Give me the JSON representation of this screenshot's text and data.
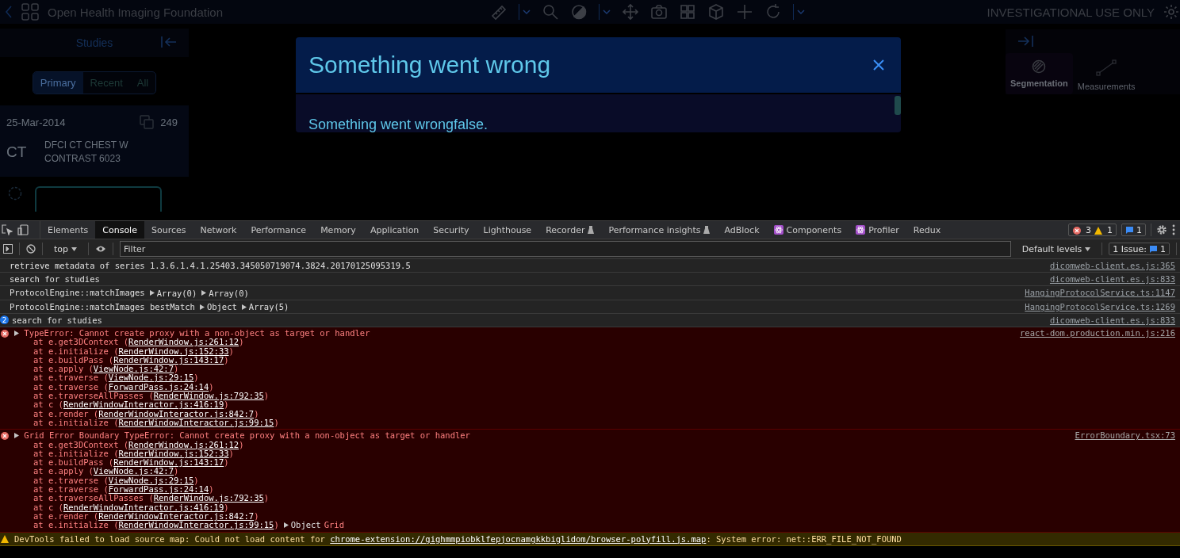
{
  "app": {
    "title": "Open Health Imaging Foundation",
    "notice": "INVESTIGATIONAL USE ONLY",
    "studies_panel": {
      "title": "Studies",
      "tabs": [
        {
          "label": "Primary",
          "selected": true
        },
        {
          "label": "Recent",
          "selected": false
        },
        {
          "label": "All",
          "selected": false
        }
      ],
      "study": {
        "date": "25-Mar-2014",
        "count": "249",
        "modality": "CT",
        "description": "DFCI CT CHEST W CONTRAST 6023"
      }
    },
    "right_panel": {
      "tabs": [
        {
          "label": "Segmentation",
          "selected": true,
          "kind": "segmentation"
        },
        {
          "label": "Measurements",
          "selected": false,
          "kind": "measurements"
        }
      ]
    },
    "modal": {
      "title": "Something went wrong",
      "message": "Something went wrongfalse."
    }
  },
  "devtools": {
    "tabs": [
      {
        "label": "Elements",
        "selected": false,
        "kind": "plain"
      },
      {
        "label": "Console",
        "selected": true,
        "kind": "plain"
      },
      {
        "label": "Sources",
        "selected": false,
        "kind": "plain"
      },
      {
        "label": "Network",
        "selected": false,
        "kind": "plain"
      },
      {
        "label": "Performance",
        "selected": false,
        "kind": "plain"
      },
      {
        "label": "Memory",
        "selected": false,
        "kind": "plain"
      },
      {
        "label": "Application",
        "selected": false,
        "kind": "plain"
      },
      {
        "label": "Security",
        "selected": false,
        "kind": "plain"
      },
      {
        "label": "Lighthouse",
        "selected": false,
        "kind": "plain"
      },
      {
        "label": "Recorder",
        "selected": false,
        "kind": "lab"
      },
      {
        "label": "Performance insights",
        "selected": false,
        "kind": "lab"
      },
      {
        "label": "AdBlock",
        "selected": false,
        "kind": "plain"
      },
      {
        "label": "Components",
        "selected": false,
        "kind": "react"
      },
      {
        "label": "Profiler",
        "selected": false,
        "kind": "react"
      },
      {
        "label": "Redux",
        "selected": false,
        "kind": "plain"
      }
    ],
    "counts": {
      "errors": "3",
      "warnings": "1",
      "messages": "1"
    },
    "context": "top",
    "filter_placeholder": "Filter",
    "levels": "Default levels",
    "issues": {
      "label": "1 Issue:",
      "count": "1"
    },
    "messages": [
      {
        "kind": "log",
        "text": "retrieve metadata of series 1.3.6.1.4.1.25403.345050719074.3824.20170125095319.5",
        "source": "dicomweb-client.es.js:365"
      },
      {
        "kind": "log",
        "text": "search for studies",
        "source": "dicomweb-client.es.js:833"
      },
      {
        "kind": "log",
        "text": "ProtocolEngine::matchImages",
        "args": [
          "Array(0)",
          "Array(0)"
        ],
        "source": "HangingProtocolService.ts:1147"
      },
      {
        "kind": "log",
        "text": "ProtocolEngine::matchImages bestMatch",
        "args": [
          "Object",
          "Array(5)"
        ],
        "source": "HangingProtocolService.ts:1269"
      },
      {
        "kind": "log",
        "count": "2",
        "text": "search for studies",
        "source": "dicomweb-client.es.js:833"
      },
      {
        "kind": "error",
        "text": "TypeError: Cannot create proxy with a non-object as target or handler",
        "source": "react-dom.production.min.js:216",
        "stack": [
          {
            "at": "at e.get3DContext (",
            "file": "RenderWindow.js:261:12",
            "end": ")"
          },
          {
            "at": "at e.initialize (",
            "file": "RenderWindow.js:152:33",
            "end": ")"
          },
          {
            "at": "at e.buildPass (",
            "file": "RenderWindow.js:143:17",
            "end": ")"
          },
          {
            "at": "at e.apply (",
            "file": "ViewNode.js:42:7",
            "end": ")"
          },
          {
            "at": "at e.traverse (",
            "file": "ViewNode.js:29:15",
            "end": ")"
          },
          {
            "at": "at e.traverse (",
            "file": "ForwardPass.js:24:14",
            "end": ")"
          },
          {
            "at": "at e.traverseAllPasses (",
            "file": "RenderWindow.js:792:35",
            "end": ")"
          },
          {
            "at": "at c (",
            "file": "RenderWindowInteractor.js:416:19",
            "end": ")"
          },
          {
            "at": "at e.render (",
            "file": "RenderWindowInteractor.js:842:7",
            "end": ")"
          },
          {
            "at": "at e.initialize (",
            "file": "RenderWindowInteractor.js:99:15",
            "end": ")"
          }
        ]
      },
      {
        "kind": "error",
        "text": "Grid Error Boundary TypeError: Cannot create proxy with a non-object as target or handler",
        "source": "ErrorBoundary.tsx:73",
        "stack": [
          {
            "at": "at e.get3DContext (",
            "file": "RenderWindow.js:261:12",
            "end": ")"
          },
          {
            "at": "at e.initialize (",
            "file": "RenderWindow.js:152:33",
            "end": ")"
          },
          {
            "at": "at e.buildPass (",
            "file": "RenderWindow.js:143:17",
            "end": ")"
          },
          {
            "at": "at e.apply (",
            "file": "ViewNode.js:42:7",
            "end": ")"
          },
          {
            "at": "at e.traverse (",
            "file": "ViewNode.js:29:15",
            "end": ")"
          },
          {
            "at": "at e.traverse (",
            "file": "ForwardPass.js:24:14",
            "end": ")"
          },
          {
            "at": "at e.traverseAllPasses (",
            "file": "RenderWindow.js:792:35",
            "end": ")"
          },
          {
            "at": "at c (",
            "file": "RenderWindowInteractor.js:416:19",
            "end": ")"
          },
          {
            "at": "at e.render (",
            "file": "RenderWindowInteractor.js:842:7",
            "end": ")"
          },
          {
            "at": "at e.initialize (",
            "file": "RenderWindowInteractor.js:99:15",
            "end": ")"
          }
        ],
        "args": [
          "Object"
        ],
        "tail": "Grid"
      },
      {
        "kind": "warning",
        "text": "DevTools failed to load source map: Could not load content for ",
        "link": "chrome-extension://gighmmpiobklfepjocnamgkkbiglidom/browser-polyfill.js.map",
        "after": ": System error: net::ERR_FILE_NOT_FOUND"
      }
    ]
  }
}
